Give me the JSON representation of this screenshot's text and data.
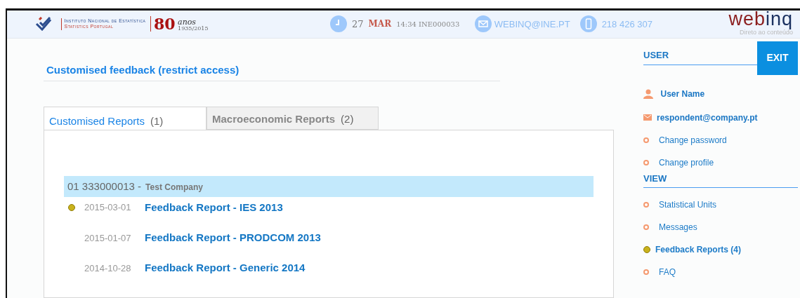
{
  "header": {
    "org_name": "Instituto Nacional de Estatística",
    "org_subtitle": "Statistics Portugal",
    "anniversary": {
      "number": "80",
      "word": "anos",
      "years": "1935/2015"
    },
    "date": {
      "day": "27",
      "month": "MAR",
      "time_code": "14:34 INE000033"
    },
    "email": "WEBINQ@INE.PT",
    "phone": "218 426 307",
    "brand": {
      "name_a": "web",
      "name_b": "inq",
      "tagline": "Direto ao conteúdo"
    }
  },
  "page_title": "Customised feedback (restrict access)",
  "tabs": [
    {
      "label": "Customised Reports",
      "count": "(1)",
      "selected": true
    },
    {
      "label": "Macroeconomic Reports",
      "count": "(2)",
      "selected": false
    }
  ],
  "group": {
    "code": "01 333000013 -",
    "name": "Test Company"
  },
  "reports": [
    {
      "date": "2015-03-01",
      "title": "Feedback Report - IES 2013",
      "new": true
    },
    {
      "date": "2015-01-07",
      "title": "Feedback Report - PRODCOM 2013",
      "new": false
    },
    {
      "date": "2014-10-28",
      "title": "Feedback Report - Generic 2014",
      "new": false
    }
  ],
  "sidebar": {
    "user_heading": "USER",
    "exit_button": "EXIT",
    "user_name": "User Name",
    "user_email": "respondent@company.pt",
    "user_links": [
      {
        "label": "Change password"
      },
      {
        "label": "Change profile"
      }
    ],
    "view_heading": "VIEW",
    "view_items": [
      {
        "label": "Statistical Units",
        "selected": false
      },
      {
        "label": "Messages",
        "selected": false
      },
      {
        "label": "Feedback Reports (4)",
        "selected": true
      },
      {
        "label": "FAQ",
        "selected": false
      }
    ]
  }
}
